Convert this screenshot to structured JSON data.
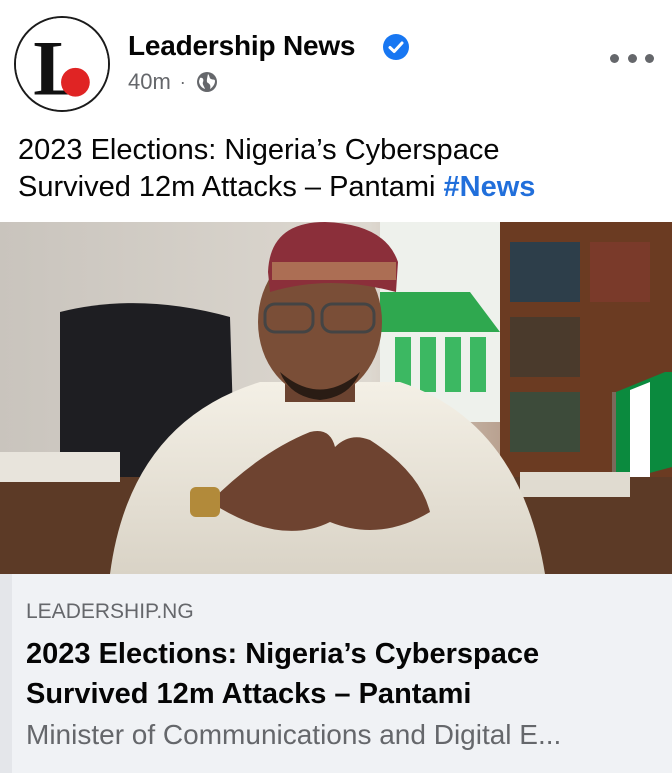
{
  "header": {
    "page_name": "Leadership News",
    "verified_icon": "verified-badge-icon",
    "time": "40m",
    "separator": "·",
    "audience_icon": "globe-icon",
    "more_icon": "more-options-icon",
    "avatar_letter": "L"
  },
  "post": {
    "caption_line1": "2023 Elections: Nigeria’s Cyberspace",
    "caption_line2": "Survived 12m Attacks – Pantami",
    "hashtag": "#News"
  },
  "link_preview": {
    "domain": "LEADERSHIP.NG",
    "title_line1": "2023 Elections: Nigeria’s Cyberspace",
    "title_line2": "Survived 12m Attacks – Pantami",
    "description": "Minister of Communications and Digital E..."
  },
  "colors": {
    "accent_blue": "#216fdb",
    "verified_blue": "#1877f2",
    "logo_red": "#e02424",
    "secondary_text": "#65676b"
  }
}
